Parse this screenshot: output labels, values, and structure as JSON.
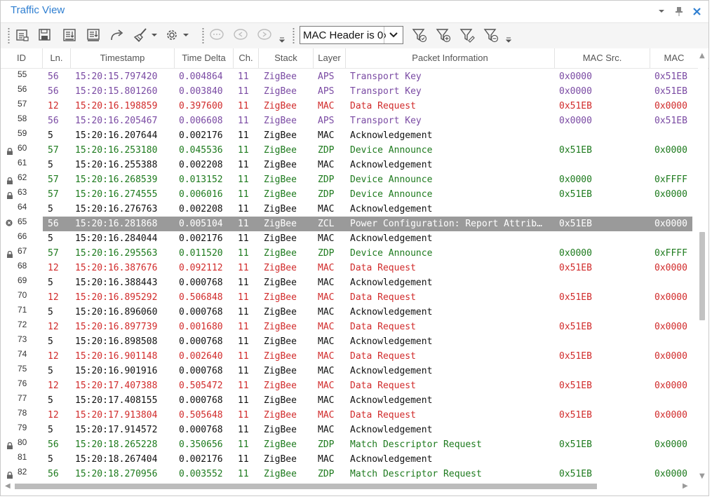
{
  "window": {
    "title": "Traffic View"
  },
  "toolbar": {
    "filter_value": "MAC Header is 0x"
  },
  "columns": [
    "ID",
    "Ln.",
    "Timestamp",
    "Time Delta",
    "Ch.",
    "Stack",
    "Layer",
    "Packet Information",
    "MAC Src.",
    "MAC"
  ],
  "colors": {
    "purple": "#7a4aa3",
    "red": "#d12b2b",
    "black": "#111111",
    "green": "#1d7a1d",
    "accent": "#2f7fd1",
    "selection": "#9a9a9a"
  },
  "rows": [
    {
      "id": "55",
      "ln": "56",
      "ts": "15:20:15.797420",
      "td": "0.004864",
      "ch": "11",
      "stack": "ZigBee",
      "layer": "APS",
      "info": "Transport Key",
      "src": "0x0000",
      "dst": "0x51EB",
      "color": "purple",
      "lock": false,
      "selected": false
    },
    {
      "id": "56",
      "ln": "56",
      "ts": "15:20:15.801260",
      "td": "0.003840",
      "ch": "11",
      "stack": "ZigBee",
      "layer": "APS",
      "info": "Transport Key",
      "src": "0x0000",
      "dst": "0x51EB",
      "color": "purple",
      "lock": false,
      "selected": false
    },
    {
      "id": "57",
      "ln": "12",
      "ts": "15:20:16.198859",
      "td": "0.397600",
      "ch": "11",
      "stack": "ZigBee",
      "layer": "MAC",
      "info": "Data Request",
      "src": "0x51EB",
      "dst": "0x0000",
      "color": "red",
      "lock": false,
      "selected": false
    },
    {
      "id": "58",
      "ln": "56",
      "ts": "15:20:16.205467",
      "td": "0.006608",
      "ch": "11",
      "stack": "ZigBee",
      "layer": "APS",
      "info": "Transport Key",
      "src": "0x0000",
      "dst": "0x51EB",
      "color": "purple",
      "lock": false,
      "selected": false
    },
    {
      "id": "59",
      "ln": "5",
      "ts": "15:20:16.207644",
      "td": "0.002176",
      "ch": "11",
      "stack": "ZigBee",
      "layer": "MAC",
      "info": "Acknowledgement",
      "src": "",
      "dst": "",
      "color": "black",
      "lock": false,
      "selected": false
    },
    {
      "id": "60",
      "ln": "57",
      "ts": "15:20:16.253180",
      "td": "0.045536",
      "ch": "11",
      "stack": "ZigBee",
      "layer": "ZDP",
      "info": "Device Announce",
      "src": "0x51EB",
      "dst": "0x0000",
      "color": "green",
      "lock": true,
      "selected": false
    },
    {
      "id": "61",
      "ln": "5",
      "ts": "15:20:16.255388",
      "td": "0.002208",
      "ch": "11",
      "stack": "ZigBee",
      "layer": "MAC",
      "info": "Acknowledgement",
      "src": "",
      "dst": "",
      "color": "black",
      "lock": false,
      "selected": false
    },
    {
      "id": "62",
      "ln": "57",
      "ts": "15:20:16.268539",
      "td": "0.013152",
      "ch": "11",
      "stack": "ZigBee",
      "layer": "ZDP",
      "info": "Device Announce",
      "src": "0x0000",
      "dst": "0xFFFF",
      "color": "green",
      "lock": true,
      "selected": false
    },
    {
      "id": "63",
      "ln": "57",
      "ts": "15:20:16.274555",
      "td": "0.006016",
      "ch": "11",
      "stack": "ZigBee",
      "layer": "ZDP",
      "info": "Device Announce",
      "src": "0x51EB",
      "dst": "0x0000",
      "color": "green",
      "lock": true,
      "selected": false
    },
    {
      "id": "64",
      "ln": "5",
      "ts": "15:20:16.276763",
      "td": "0.002208",
      "ch": "11",
      "stack": "ZigBee",
      "layer": "MAC",
      "info": "Acknowledgement",
      "src": "",
      "dst": "",
      "color": "black",
      "lock": false,
      "selected": false
    },
    {
      "id": "65",
      "ln": "56",
      "ts": "15:20:16.281868",
      "td": "0.005104",
      "ch": "11",
      "stack": "ZigBee",
      "layer": "ZCL",
      "info": "Power Configuration: Report Attrib…",
      "src": "0x51EB",
      "dst": "0x0000",
      "color": "black",
      "lock": false,
      "selected": true
    },
    {
      "id": "66",
      "ln": "5",
      "ts": "15:20:16.284044",
      "td": "0.002176",
      "ch": "11",
      "stack": "ZigBee",
      "layer": "MAC",
      "info": "Acknowledgement",
      "src": "",
      "dst": "",
      "color": "black",
      "lock": false,
      "selected": false
    },
    {
      "id": "67",
      "ln": "57",
      "ts": "15:20:16.295563",
      "td": "0.011520",
      "ch": "11",
      "stack": "ZigBee",
      "layer": "ZDP",
      "info": "Device Announce",
      "src": "0x0000",
      "dst": "0xFFFF",
      "color": "green",
      "lock": true,
      "selected": false
    },
    {
      "id": "68",
      "ln": "12",
      "ts": "15:20:16.387676",
      "td": "0.092112",
      "ch": "11",
      "stack": "ZigBee",
      "layer": "MAC",
      "info": "Data Request",
      "src": "0x51EB",
      "dst": "0x0000",
      "color": "red",
      "lock": false,
      "selected": false
    },
    {
      "id": "69",
      "ln": "5",
      "ts": "15:20:16.388443",
      "td": "0.000768",
      "ch": "11",
      "stack": "ZigBee",
      "layer": "MAC",
      "info": "Acknowledgement",
      "src": "",
      "dst": "",
      "color": "black",
      "lock": false,
      "selected": false
    },
    {
      "id": "70",
      "ln": "12",
      "ts": "15:20:16.895292",
      "td": "0.506848",
      "ch": "11",
      "stack": "ZigBee",
      "layer": "MAC",
      "info": "Data Request",
      "src": "0x51EB",
      "dst": "0x0000",
      "color": "red",
      "lock": false,
      "selected": false
    },
    {
      "id": "71",
      "ln": "5",
      "ts": "15:20:16.896060",
      "td": "0.000768",
      "ch": "11",
      "stack": "ZigBee",
      "layer": "MAC",
      "info": "Acknowledgement",
      "src": "",
      "dst": "",
      "color": "black",
      "lock": false,
      "selected": false
    },
    {
      "id": "72",
      "ln": "12",
      "ts": "15:20:16.897739",
      "td": "0.001680",
      "ch": "11",
      "stack": "ZigBee",
      "layer": "MAC",
      "info": "Data Request",
      "src": "0x51EB",
      "dst": "0x0000",
      "color": "red",
      "lock": false,
      "selected": false
    },
    {
      "id": "73",
      "ln": "5",
      "ts": "15:20:16.898508",
      "td": "0.000768",
      "ch": "11",
      "stack": "ZigBee",
      "layer": "MAC",
      "info": "Acknowledgement",
      "src": "",
      "dst": "",
      "color": "black",
      "lock": false,
      "selected": false
    },
    {
      "id": "74",
      "ln": "12",
      "ts": "15:20:16.901148",
      "td": "0.002640",
      "ch": "11",
      "stack": "ZigBee",
      "layer": "MAC",
      "info": "Data Request",
      "src": "0x51EB",
      "dst": "0x0000",
      "color": "red",
      "lock": false,
      "selected": false
    },
    {
      "id": "75",
      "ln": "5",
      "ts": "15:20:16.901916",
      "td": "0.000768",
      "ch": "11",
      "stack": "ZigBee",
      "layer": "MAC",
      "info": "Acknowledgement",
      "src": "",
      "dst": "",
      "color": "black",
      "lock": false,
      "selected": false
    },
    {
      "id": "76",
      "ln": "12",
      "ts": "15:20:17.407388",
      "td": "0.505472",
      "ch": "11",
      "stack": "ZigBee",
      "layer": "MAC",
      "info": "Data Request",
      "src": "0x51EB",
      "dst": "0x0000",
      "color": "red",
      "lock": false,
      "selected": false
    },
    {
      "id": "77",
      "ln": "5",
      "ts": "15:20:17.408155",
      "td": "0.000768",
      "ch": "11",
      "stack": "ZigBee",
      "layer": "MAC",
      "info": "Acknowledgement",
      "src": "",
      "dst": "",
      "color": "black",
      "lock": false,
      "selected": false
    },
    {
      "id": "78",
      "ln": "12",
      "ts": "15:20:17.913804",
      "td": "0.505648",
      "ch": "11",
      "stack": "ZigBee",
      "layer": "MAC",
      "info": "Data Request",
      "src": "0x51EB",
      "dst": "0x0000",
      "color": "red",
      "lock": false,
      "selected": false
    },
    {
      "id": "79",
      "ln": "5",
      "ts": "15:20:17.914572",
      "td": "0.000768",
      "ch": "11",
      "stack": "ZigBee",
      "layer": "MAC",
      "info": "Acknowledgement",
      "src": "",
      "dst": "",
      "color": "black",
      "lock": false,
      "selected": false
    },
    {
      "id": "80",
      "ln": "56",
      "ts": "15:20:18.265228",
      "td": "0.350656",
      "ch": "11",
      "stack": "ZigBee",
      "layer": "ZDP",
      "info": "Match Descriptor Request",
      "src": "0x51EB",
      "dst": "0x0000",
      "color": "green",
      "lock": true,
      "selected": false
    },
    {
      "id": "81",
      "ln": "5",
      "ts": "15:20:18.267404",
      "td": "0.002176",
      "ch": "11",
      "stack": "ZigBee",
      "layer": "MAC",
      "info": "Acknowledgement",
      "src": "",
      "dst": "",
      "color": "black",
      "lock": false,
      "selected": false
    },
    {
      "id": "82",
      "ln": "56",
      "ts": "15:20:18.270956",
      "td": "0.003552",
      "ch": "11",
      "stack": "ZigBee",
      "layer": "ZDP",
      "info": "Match Descriptor Request",
      "src": "0x51EB",
      "dst": "0x0000",
      "color": "green",
      "lock": true,
      "selected": false
    }
  ]
}
